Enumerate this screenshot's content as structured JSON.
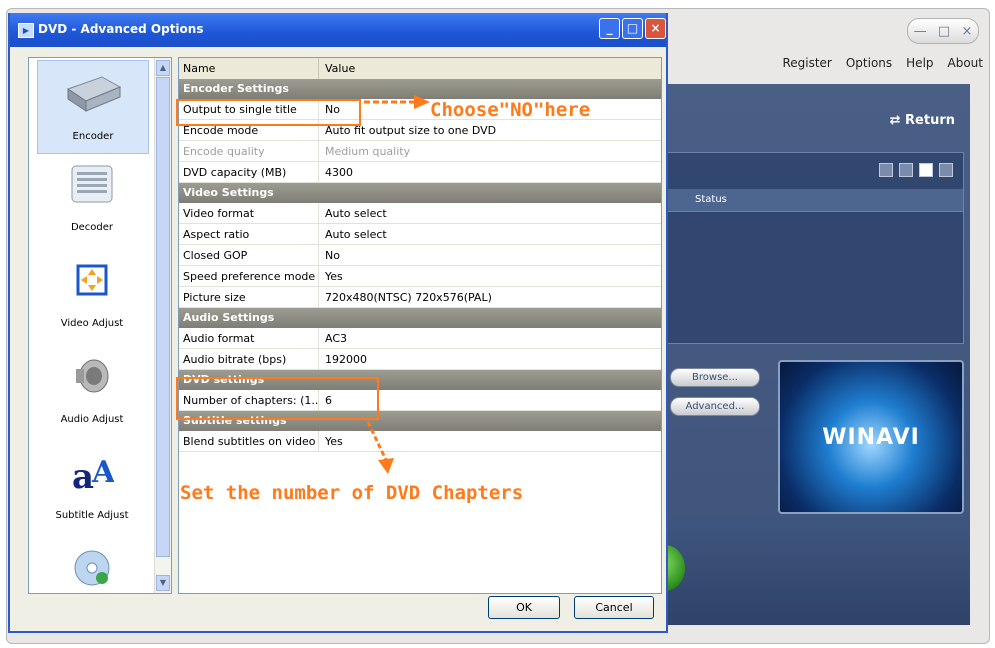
{
  "app": {
    "menu": [
      "Register",
      "Options",
      "Help",
      "About"
    ],
    "return_label": "Return",
    "status_header": "Status",
    "browse_label": "Browse...",
    "advanced_label": "Advanced...",
    "logo_text": "WINAVI"
  },
  "dialog": {
    "title": "DVD - Advanced Options",
    "ok_label": "OK",
    "cancel_label": "Cancel"
  },
  "sidebar": {
    "items": [
      {
        "label": "Encoder",
        "icon": "encoder-icon"
      },
      {
        "label": "Decoder",
        "icon": "decoder-icon"
      },
      {
        "label": "Video Adjust",
        "icon": "video-adjust-icon"
      },
      {
        "label": "Audio Adjust",
        "icon": "audio-adjust-icon"
      },
      {
        "label": "Subtitle Adjust",
        "icon": "subtitle-adjust-icon"
      }
    ]
  },
  "grid": {
    "headers": {
      "name": "Name",
      "value": "Value"
    },
    "rows": [
      {
        "type": "section",
        "name": "Encoder Settings"
      },
      {
        "type": "data",
        "name": "Output to single title",
        "value": "No"
      },
      {
        "type": "data",
        "name": "Encode mode",
        "value": "Auto fit output size to one DVD"
      },
      {
        "type": "data",
        "name": "Encode quality",
        "value": "Medium quality",
        "disabled": true
      },
      {
        "type": "data",
        "name": "DVD capacity (MB)",
        "value": "4300"
      },
      {
        "type": "section",
        "name": "Video Settings"
      },
      {
        "type": "data",
        "name": "Video format",
        "value": "Auto select"
      },
      {
        "type": "data",
        "name": "Aspect ratio",
        "value": "Auto select"
      },
      {
        "type": "data",
        "name": "Closed GOP",
        "value": "No"
      },
      {
        "type": "data",
        "name": "Speed preference mode",
        "value": "Yes"
      },
      {
        "type": "data",
        "name": "Picture size",
        "value": "720x480(NTSC) 720x576(PAL)"
      },
      {
        "type": "section",
        "name": "Audio Settings"
      },
      {
        "type": "data",
        "name": "Audio format",
        "value": "AC3"
      },
      {
        "type": "data",
        "name": "Audio bitrate (bps)",
        "value": "192000"
      },
      {
        "type": "section",
        "name": "DVD settings"
      },
      {
        "type": "data",
        "name": "Number of chapters: (1...",
        "value": "6"
      },
      {
        "type": "section",
        "name": "Subtitle settings"
      },
      {
        "type": "data",
        "name": "Blend subtitles on video",
        "value": "Yes"
      }
    ]
  },
  "annotations": {
    "choose_no": "Choose\"NO\"here",
    "set_chapters": "Set the number of DVD Chapters"
  },
  "colors": {
    "annotation": "#ff7a1a",
    "titlebar": "#1e56d6",
    "section_row": "#8f8e85"
  }
}
